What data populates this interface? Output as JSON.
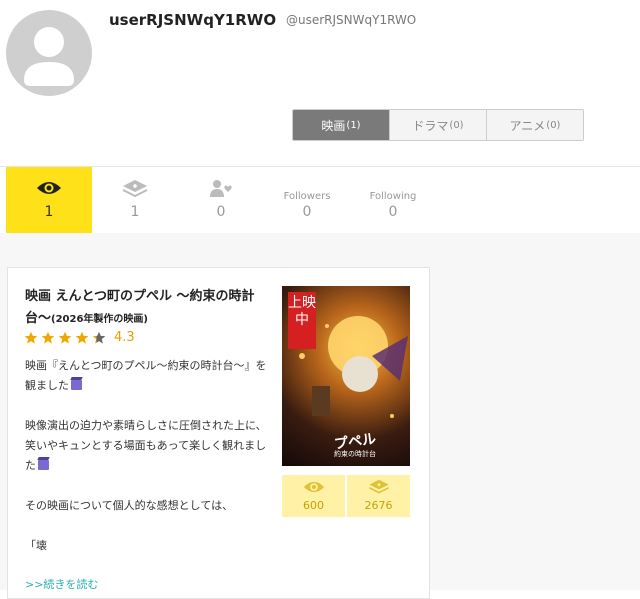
{
  "profile": {
    "username": "userRJSNWqY1RWO",
    "handle": "@userRJSNWqY1RWO"
  },
  "tabs": [
    {
      "label": "映画",
      "count": "(1)",
      "active": true
    },
    {
      "label": "ドラマ",
      "count": "(0)",
      "active": false
    },
    {
      "label": "アニメ",
      "count": "(0)",
      "active": false
    }
  ],
  "stats": {
    "watched": "1",
    "wishlist": "1",
    "likes": "0",
    "followers_label": "Followers",
    "followers": "0",
    "following_label": "Following",
    "following": "0"
  },
  "review": {
    "title": "映画 えんとつ町のプペル ～約束の時計台～",
    "year_note": "(2026年製作の映画)",
    "rating": "4.3",
    "stars_filled": 4.3,
    "lines": [
      "映画『えんとつ町のプペル～約束の時計台～』を観ました",
      "映像演出の迫力や素晴らしさに圧倒された上に、笑いやキュンとする場面もあって楽しく観れました",
      "その映画について個人的な感想としては、",
      "「壊"
    ],
    "read_more": ">>続きを読む"
  },
  "poster": {
    "badge": "上映中",
    "title": "プペル",
    "subtitle": "約束の時計台",
    "watched_count": "600",
    "wish_count": "2676"
  },
  "colors": {
    "accent_yellow": "#ffe11a",
    "rating_orange": "#e8a000",
    "link_teal": "#2ab0b0"
  }
}
